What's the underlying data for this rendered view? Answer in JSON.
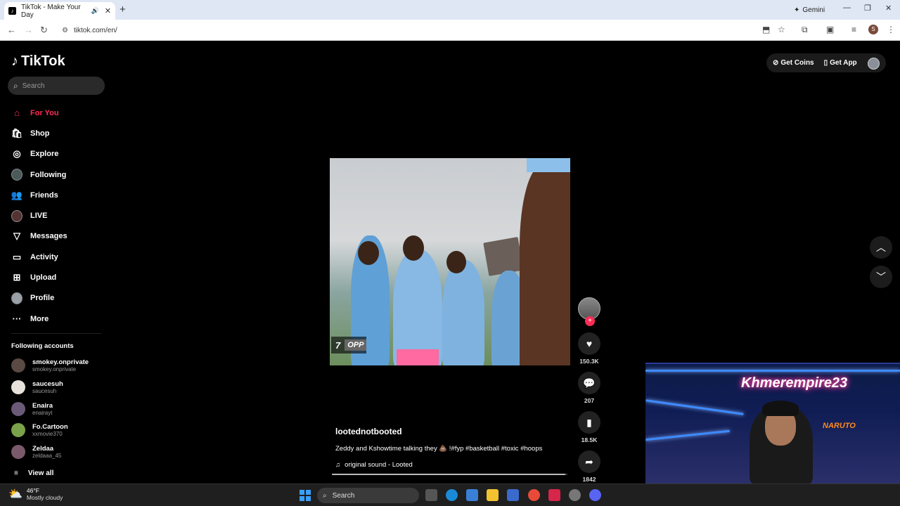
{
  "browser": {
    "tab_title": "TikTok - Make Your Day",
    "url": "tiktok.com/en/",
    "gemini_label": "Gemini",
    "profile_initial": "S"
  },
  "tiktok": {
    "logo_text": "TikTok",
    "search_placeholder": "Search",
    "nav": [
      {
        "label": "For You",
        "icon": "home-icon"
      },
      {
        "label": "Shop",
        "icon": "shop-icon"
      },
      {
        "label": "Explore",
        "icon": "compass-icon"
      },
      {
        "label": "Following",
        "icon": "following-avatar-icon"
      },
      {
        "label": "Friends",
        "icon": "friends-icon"
      },
      {
        "label": "LIVE",
        "icon": "live-icon"
      },
      {
        "label": "Messages",
        "icon": "messages-icon"
      },
      {
        "label": "Activity",
        "icon": "activity-icon"
      },
      {
        "label": "Upload",
        "icon": "upload-icon"
      },
      {
        "label": "Profile",
        "icon": "profile-icon"
      },
      {
        "label": "More",
        "icon": "more-icon"
      }
    ],
    "following_header": "Following accounts",
    "accounts": [
      {
        "name": "smokey.onprivate",
        "handle": "smokey.onprivate",
        "color": "#5a4a44"
      },
      {
        "name": "saucesuh",
        "handle": "saucesuh",
        "color": "#e8e2dc"
      },
      {
        "name": "Enaira",
        "handle": "enairayt",
        "color": "#6a5a78"
      },
      {
        "name": "Fo.Cartoon",
        "handle": "xxmovie370",
        "color": "#7aa24a"
      },
      {
        "name": "Zeldaa",
        "handle": "zeldaaa_45",
        "color": "#7a5a6a"
      }
    ],
    "view_all": "View all",
    "get_coins": "Get Coins",
    "get_app": "Get App",
    "video": {
      "score_number": "7",
      "score_team": "OPP",
      "username": "lootednotbooted",
      "caption": "Zeddy and Kshowtime talking they 💩 !#fyp #basketball #toxic #hoops",
      "sound": "original sound - Looted",
      "progress": 0.99,
      "likes": "150.3K",
      "comments": "207",
      "saves": "18.5K",
      "shares": "1842"
    }
  },
  "overlay": {
    "neon_text": "Khmerempire23",
    "sign_text": "NARUTO"
  },
  "taskbar": {
    "temp": "46°F",
    "condition": "Mostly cloudy",
    "search_label": "Search"
  },
  "colors": {
    "accent": "#fe2c55"
  }
}
